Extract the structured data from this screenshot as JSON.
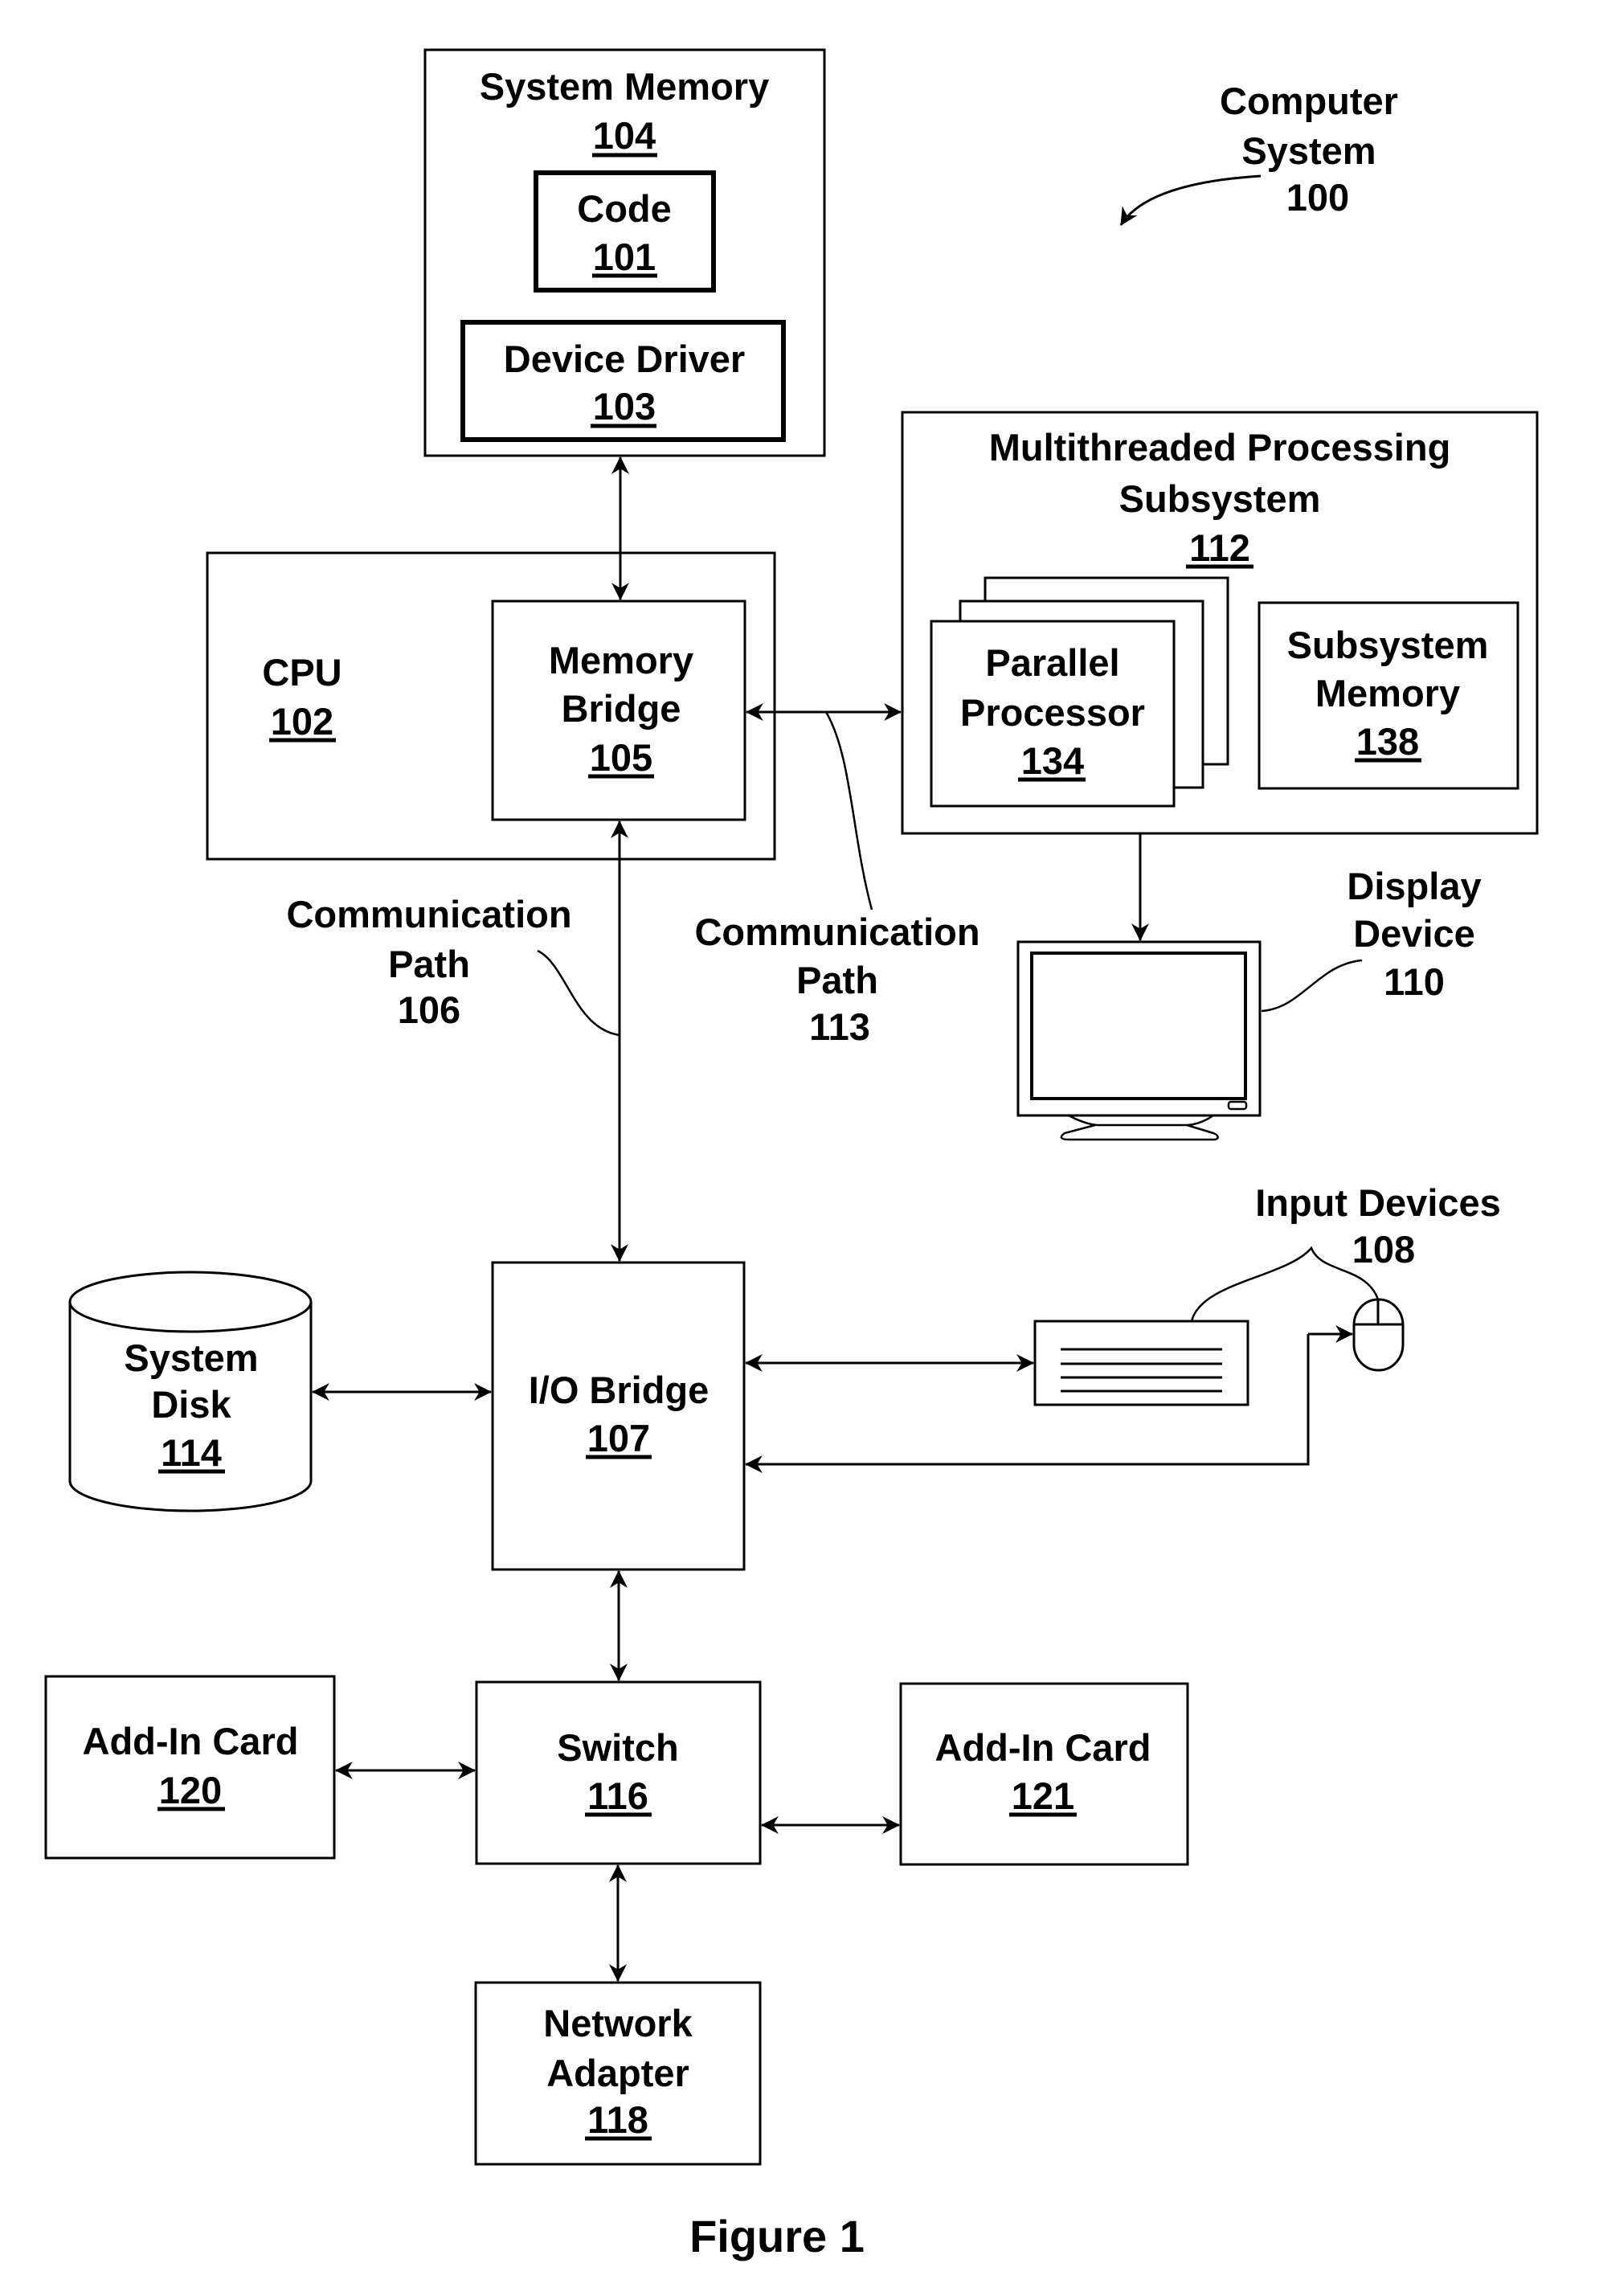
{
  "figure": {
    "caption": "Figure 1",
    "colors": {
      "ink": "#000000",
      "paper": "#ffffff"
    }
  },
  "computer_system": {
    "lines": [
      "Computer",
      "System"
    ],
    "ref": "100"
  },
  "system_memory": {
    "title": "System Memory",
    "ref": "104",
    "code": {
      "title": "Code",
      "ref": "101"
    },
    "device_driver": {
      "title": "Device Driver",
      "ref": "103"
    }
  },
  "cpu": {
    "title": "CPU",
    "ref": "102",
    "memory_bridge": {
      "lines": [
        "Memory",
        "Bridge"
      ],
      "ref": "105"
    }
  },
  "mps": {
    "lines": [
      "Multithreaded Processing",
      "Subsystem"
    ],
    "ref": "112",
    "parallel_processor": {
      "lines": [
        "Parallel",
        "Processor"
      ],
      "ref": "134"
    },
    "subsystem_memory": {
      "lines": [
        "Subsystem",
        "Memory"
      ],
      "ref": "138"
    }
  },
  "comm_path_106": {
    "lines": [
      "Communication",
      "Path"
    ],
    "ref": "106"
  },
  "comm_path_113": {
    "lines": [
      "Communication",
      "Path"
    ],
    "ref": "113"
  },
  "display_device": {
    "lines": [
      "Display",
      "Device"
    ],
    "ref": "110"
  },
  "input_devices": {
    "title": "Input Devices",
    "ref": "108"
  },
  "io_bridge": {
    "title": "I/O Bridge",
    "ref": "107"
  },
  "system_disk": {
    "lines": [
      "System",
      "Disk"
    ],
    "ref": "114"
  },
  "switch": {
    "title": "Switch",
    "ref": "116"
  },
  "add_in_card_120": {
    "title": "Add-In Card",
    "ref": "120"
  },
  "add_in_card_121": {
    "title": "Add-In Card",
    "ref": "121"
  },
  "network_adapter": {
    "lines": [
      "Network",
      "Adapter"
    ],
    "ref": "118"
  }
}
